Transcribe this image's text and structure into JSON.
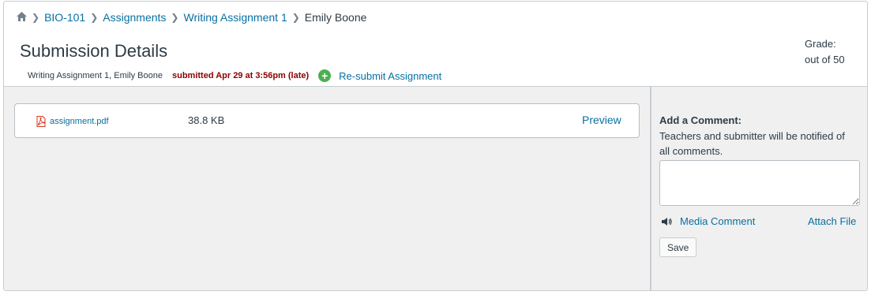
{
  "breadcrumb": {
    "items": [
      {
        "label": "BIO-101"
      },
      {
        "label": "Assignments"
      },
      {
        "label": "Writing Assignment 1"
      },
      {
        "label": "Emily Boone"
      }
    ]
  },
  "header": {
    "title": "Submission Details",
    "meta": "Writing Assignment 1, Emily Boone",
    "submitted": "submitted Apr 29 at 3:56pm (late)",
    "resubmit_label": "Re-submit Assignment",
    "grade_label": "Grade:",
    "grade_out_of": "out of 50"
  },
  "file": {
    "name": "assignment.pdf",
    "size": "38.8 KB",
    "preview_label": "Preview"
  },
  "comment": {
    "title": "Add a Comment:",
    "note": "Teachers and submitter will be notified of all comments.",
    "placeholder": "",
    "media_label": "Media Comment",
    "attach_label": "Attach File",
    "save_label": "Save"
  },
  "colors": {
    "link": "#0770a3",
    "late": "#8b0000",
    "resubmit_icon": "#4caf50",
    "panel_bg": "#f0f0f0"
  },
  "icons": [
    "home-icon",
    "chevron-right-icon",
    "plus-circle-icon",
    "pdf-file-icon",
    "speaker-icon"
  ]
}
